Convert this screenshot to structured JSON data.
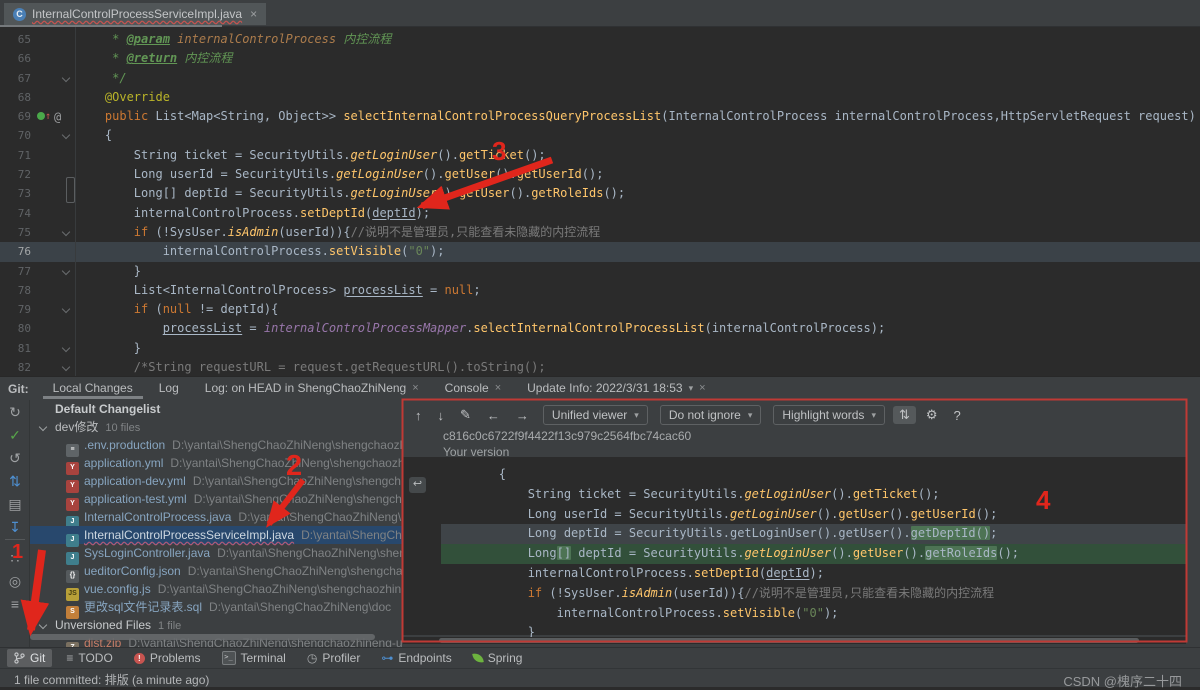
{
  "tab": {
    "icon_letter": "C",
    "title": "InternalControlProcessServiceImpl.java",
    "close": "×"
  },
  "editor": {
    "lines": [
      {
        "num": "65",
        "mark": "",
        "cur": false,
        "seg": [
          [
            "     * ",
            "doc"
          ],
          [
            "@param",
            "docTag"
          ],
          [
            " ",
            "doc"
          ],
          [
            "internalControlProcess",
            "docParam"
          ],
          [
            " 内控流程",
            "doc"
          ]
        ]
      },
      {
        "num": "66",
        "mark": "",
        "cur": false,
        "seg": [
          [
            "     * ",
            "doc"
          ],
          [
            "@return",
            "docTag"
          ],
          [
            " 内控流程",
            "doc"
          ]
        ]
      },
      {
        "num": "67",
        "mark": "fold",
        "cur": false,
        "seg": [
          [
            "     */",
            "doc"
          ]
        ]
      },
      {
        "num": "68",
        "mark": "",
        "cur": false,
        "seg": [
          [
            "    ",
            ""
          ],
          [
            "@Override",
            "ann"
          ]
        ]
      },
      {
        "num": "69",
        "mark": "ovr",
        "cur": false,
        "seg": [
          [
            "    ",
            ""
          ],
          [
            "public ",
            "kw"
          ],
          [
            "List<Map<String, Object>> ",
            ""
          ],
          [
            "selectInternalControlProcessQueryProcessList",
            "mDecl"
          ],
          [
            "(InternalControlProcess internalControlProcess,HttpServletRequest request)",
            ""
          ]
        ]
      },
      {
        "num": "70",
        "mark": "fold",
        "cur": false,
        "seg": [
          [
            "    {",
            ""
          ]
        ]
      },
      {
        "num": "71",
        "mark": "",
        "cur": false,
        "seg": [
          [
            "        String ticket = SecurityUtils.",
            ""
          ],
          [
            "getLoginUser",
            "mi"
          ],
          [
            "().",
            ""
          ],
          [
            "getTicket",
            "m"
          ],
          [
            "();",
            ""
          ]
        ]
      },
      {
        "num": "72",
        "mark": "",
        "cur": false,
        "seg": [
          [
            "        Long userId = SecurityUtils.",
            ""
          ],
          [
            "getLoginUser",
            "mi"
          ],
          [
            "().",
            ""
          ],
          [
            "getUser",
            "m"
          ],
          [
            "().",
            ""
          ],
          [
            "getUserId",
            "m"
          ],
          [
            "();",
            ""
          ]
        ]
      },
      {
        "num": "73",
        "mark": "",
        "cur": false,
        "seg": [
          [
            "        Long[] deptId = SecurityUtils.",
            ""
          ],
          [
            "getLoginUser",
            "mi"
          ],
          [
            "().",
            ""
          ],
          [
            "getUser",
            "m"
          ],
          [
            "().",
            ""
          ],
          [
            "getRoleIds",
            "m"
          ],
          [
            "();",
            ""
          ]
        ]
      },
      {
        "num": "74",
        "mark": "",
        "cur": false,
        "seg": [
          [
            "        internalControlProcess.",
            ""
          ],
          [
            "setDeptId",
            "m"
          ],
          [
            "(",
            ""
          ],
          [
            "deptId",
            "pu"
          ],
          [
            ");",
            ""
          ]
        ]
      },
      {
        "num": "75",
        "mark": "fold",
        "cur": false,
        "seg": [
          [
            "        ",
            ""
          ],
          [
            "if",
            "kw"
          ],
          [
            " (!SysUser.",
            ""
          ],
          [
            "isAdmin",
            "mi"
          ],
          [
            "(userId)){",
            ""
          ],
          [
            "//说明不是管理员,只能查看未隐藏的内控流程",
            "cmt"
          ]
        ]
      },
      {
        "num": "76",
        "mark": "",
        "cur": true,
        "seg": [
          [
            "            internalControlProcess.",
            ""
          ],
          [
            "setVisible",
            "m"
          ],
          [
            "(",
            ""
          ],
          [
            "\"0\"",
            "str"
          ],
          [
            ");",
            ""
          ]
        ]
      },
      {
        "num": "77",
        "mark": "fold",
        "cur": false,
        "seg": [
          [
            "        }",
            ""
          ]
        ]
      },
      {
        "num": "78",
        "mark": "",
        "cur": false,
        "seg": [
          [
            "        List<InternalControlProcess> ",
            ""
          ],
          [
            "processList",
            "pu"
          ],
          [
            " = ",
            ""
          ],
          [
            "null",
            "kw"
          ],
          [
            ";",
            ""
          ]
        ]
      },
      {
        "num": "79",
        "mark": "fold",
        "cur": false,
        "seg": [
          [
            "        ",
            ""
          ],
          [
            "if",
            "kw"
          ],
          [
            " (",
            ""
          ],
          [
            "null",
            "kw"
          ],
          [
            " != deptId){",
            ""
          ]
        ]
      },
      {
        "num": "80",
        "mark": "",
        "cur": false,
        "seg": [
          [
            "            ",
            ""
          ],
          [
            "processList",
            "pu"
          ],
          [
            " = ",
            ""
          ],
          [
            "internalControlProcessMapper",
            "fld"
          ],
          [
            ".",
            ""
          ],
          [
            "selectInternalControlProcessList",
            "m"
          ],
          [
            "(internalControlProcess);",
            ""
          ]
        ]
      },
      {
        "num": "81",
        "mark": "fold",
        "cur": false,
        "seg": [
          [
            "        }",
            ""
          ]
        ]
      },
      {
        "num": "82",
        "mark": "fold",
        "cur": false,
        "seg": [
          [
            "        ",
            ""
          ],
          [
            "/*String requestURL = request.getRequestURL().toString();",
            "cmt"
          ]
        ]
      }
    ]
  },
  "git_panel": {
    "label": "Git:",
    "tabs": [
      {
        "label": "Local Changes",
        "selected": true,
        "close": "",
        "dropdown": ""
      },
      {
        "label": "Log",
        "selected": false,
        "close": "",
        "dropdown": ""
      },
      {
        "label": "Log: on HEAD in ShengChaoZhiNeng",
        "selected": false,
        "close": "×",
        "dropdown": ""
      },
      {
        "label": "Console",
        "selected": false,
        "close": "×",
        "dropdown": ""
      },
      {
        "label": "Update Info: 2022/3/31 18:53",
        "selected": false,
        "close": "×",
        "dropdown": "▾"
      }
    ],
    "side_icons": [
      {
        "name": "refresh-icon",
        "glyph": "↻",
        "color": "#9fa2a4"
      },
      {
        "name": "commit-check-icon",
        "glyph": "✓",
        "color": "#57a64a"
      },
      {
        "name": "rollback-icon",
        "glyph": "↺",
        "color": "#9fa2a4"
      },
      {
        "name": "shelve-icon",
        "glyph": "⇅",
        "color": "#4e8fd0"
      },
      {
        "name": "show-diff-icon",
        "glyph": "▤",
        "color": "#9fa2a4"
      },
      {
        "name": "unshelve-icon",
        "glyph": "↧",
        "color": "#4e8fd0"
      },
      {
        "name": "group-by-icon",
        "glyph": "∷",
        "color": "#9fa2a4"
      },
      {
        "name": "preview-icon",
        "glyph": "◎",
        "color": "#9fa2a4"
      },
      {
        "name": "expand-all-icon",
        "glyph": "≡",
        "color": "#9fa2a4"
      }
    ],
    "tree": {
      "changelist": "Default Changelist",
      "group": {
        "name": "dev修改",
        "count": "10 files"
      },
      "files": [
        {
          "type": "env",
          "letter": "≡",
          "name": ".env.production",
          "path": "D:\\yantai\\ShengChaoZhiNeng\\shengchaozhin",
          "selected": false
        },
        {
          "type": "yml",
          "letter": "Y",
          "name": "application.yml",
          "path": "D:\\yantai\\ShengChaoZhiNeng\\shengchaozhin",
          "selected": false
        },
        {
          "type": "yml",
          "letter": "Y",
          "name": "application-dev.yml",
          "path": "D:\\yantai\\ShengChaoZhiNeng\\shengcha",
          "selected": false
        },
        {
          "type": "yml",
          "letter": "Y",
          "name": "application-test.yml",
          "path": "D:\\yantai\\ShengChaoZhiNeng\\shengcha",
          "selected": false
        },
        {
          "type": "java",
          "letter": "J",
          "name": "InternalControlProcess.java",
          "path": "D:\\yantai\\ShengChaoZhiNeng\\sh",
          "selected": false
        },
        {
          "type": "java",
          "letter": "J",
          "name": "InternalControlProcessServiceImpl.java",
          "path": "D:\\yantai\\ShengChao",
          "selected": true
        },
        {
          "type": "java",
          "letter": "J",
          "name": "SysLoginController.java",
          "path": "D:\\yantai\\ShengChaoZhiNeng\\sheng",
          "selected": false
        },
        {
          "type": "json",
          "letter": "{}",
          "name": "ueditorConfig.json",
          "path": "D:\\yantai\\ShengChaoZhiNeng\\shengchao",
          "selected": false
        },
        {
          "type": "js",
          "letter": "JS",
          "name": "vue.config.js",
          "path": "D:\\yantai\\ShengChaoZhiNeng\\shengchaozhiner",
          "selected": false
        },
        {
          "type": "sql",
          "letter": "S",
          "name": "更改sql文件记录表.sql",
          "path": "D:\\yantai\\ShengChaoZhiNeng\\doc",
          "selected": false
        }
      ],
      "unversioned": {
        "name": "Unversioned Files",
        "count": "1 file"
      },
      "unversioned_files": [
        {
          "type": "zip",
          "letter": "Z",
          "name": "dist.zip",
          "path": "D:\\yantai\\ShengChaoZhiNeng\\shengchaozhineng-ui"
        }
      ]
    },
    "diff": {
      "nav_icons": [
        {
          "name": "prev-change-icon",
          "glyph": "↑"
        },
        {
          "name": "next-change-icon",
          "glyph": "↓"
        },
        {
          "name": "edit-icon",
          "glyph": "✎"
        },
        {
          "name": "prev-file-icon",
          "glyph": "←"
        },
        {
          "name": "next-file-icon",
          "glyph": "→"
        }
      ],
      "dropdowns": [
        "Unified viewer",
        "Do not ignore",
        "Highlight words"
      ],
      "right_icons": [
        {
          "name": "collapse-unchanged-icon",
          "glyph": "⇅",
          "selected": true
        },
        {
          "name": "settings-gear-icon",
          "glyph": "⚙",
          "selected": false
        },
        {
          "name": "help-icon",
          "glyph": "?",
          "selected": false
        }
      ],
      "commit_hash": "c816c0c6722f9f4422f13c979c2564fbc74cac60",
      "version_label": "Your version",
      "lines": [
        {
          "bg": "",
          "revert": false,
          "seg": [
            [
              "        {",
              ""
            ]
          ]
        },
        {
          "bg": "",
          "revert": false,
          "seg": [
            [
              "            String ticket = SecurityUtils.",
              ""
            ],
            [
              "getLoginUser",
              "mi"
            ],
            [
              "().",
              ""
            ],
            [
              "getTicket",
              "m"
            ],
            [
              "();",
              ""
            ]
          ]
        },
        {
          "bg": "",
          "revert": false,
          "seg": [
            [
              "            Long userId = SecurityUtils.",
              ""
            ],
            [
              "getLoginUser",
              "mi"
            ],
            [
              "().",
              ""
            ],
            [
              "getUser",
              "m"
            ],
            [
              "().",
              ""
            ],
            [
              "getUserId",
              "m"
            ],
            [
              "();",
              ""
            ]
          ]
        },
        {
          "bg": "old",
          "revert": true,
          "seg": [
            [
              "            Long deptId = SecurityUtils.getLoginUser().getUser().",
              ""
            ],
            [
              "getDeptId()",
              "hlw"
            ],
            [
              ";",
              ""
            ]
          ]
        },
        {
          "bg": "new",
          "revert": false,
          "seg": [
            [
              "            Long",
              ""
            ],
            [
              "[]",
              "hlw"
            ],
            [
              " deptId = SecurityUtils.",
              ""
            ],
            [
              "getLoginUser",
              "mi"
            ],
            [
              "().",
              ""
            ],
            [
              "getUser",
              "m"
            ],
            [
              "().",
              ""
            ],
            [
              "getRoleIds",
              "hlw"
            ],
            [
              "();",
              ""
            ]
          ]
        },
        {
          "bg": "",
          "revert": false,
          "seg": [
            [
              "            internalControlProcess.",
              ""
            ],
            [
              "setDeptId",
              "m"
            ],
            [
              "(",
              ""
            ],
            [
              "deptId",
              "pu"
            ],
            [
              ");",
              ""
            ]
          ]
        },
        {
          "bg": "",
          "revert": false,
          "seg": [
            [
              "            ",
              ""
            ],
            [
              "if",
              "kw"
            ],
            [
              " (!SysUser.",
              ""
            ],
            [
              "isAdmin",
              "mi"
            ],
            [
              "(userId)){",
              ""
            ],
            [
              "//说明不是管理员,只能查看未隐藏的内控流程",
              "cmt"
            ]
          ]
        },
        {
          "bg": "",
          "revert": false,
          "seg": [
            [
              "                internalControlProcess.",
              ""
            ],
            [
              "setVisible",
              "m"
            ],
            [
              "(",
              ""
            ],
            [
              "\"0\"",
              "str"
            ],
            [
              ");",
              ""
            ]
          ]
        },
        {
          "bg": "",
          "revert": false,
          "seg": [
            [
              "            }",
              ""
            ]
          ]
        }
      ]
    }
  },
  "bottom_bar": {
    "items": [
      {
        "label": "Git",
        "icon": "branch",
        "selected": true
      },
      {
        "label": "TODO",
        "icon": "todo",
        "selected": false
      },
      {
        "label": "Problems",
        "icon": "problems",
        "selected": false
      },
      {
        "label": "Terminal",
        "icon": "terminal",
        "selected": false
      },
      {
        "label": "Profiler",
        "icon": "profiler",
        "selected": false
      },
      {
        "label": "Endpoints",
        "icon": "endpoints",
        "selected": false
      },
      {
        "label": "Spring",
        "icon": "spring",
        "selected": false
      }
    ]
  },
  "status_bar": {
    "message": "1 file committed: 排版 (a minute ago)",
    "watermark": "CSDN @槐序二十四"
  },
  "annotations": {
    "n1": "1",
    "n2": "2",
    "n3": "3",
    "n4": "4"
  }
}
